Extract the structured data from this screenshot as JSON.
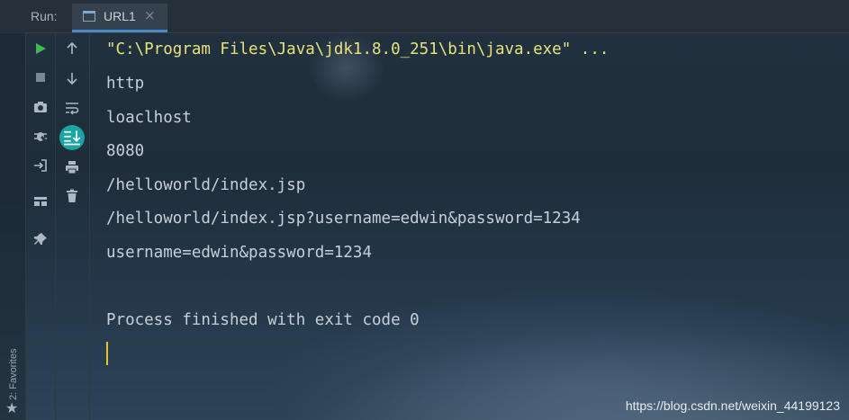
{
  "header": {
    "run_label": "Run:",
    "tab_label": "URL1",
    "tab_close": "×"
  },
  "sidebar": {
    "favorites_label": "2: Favorites",
    "favorites_icon": "star-icon"
  },
  "toolbar_left": [
    {
      "icon": "run-icon",
      "color": "#3fb950"
    },
    {
      "icon": "stop-icon"
    },
    {
      "icon": "camera-icon"
    },
    {
      "icon": "debug-bug-icon"
    },
    {
      "icon": "login-icon"
    },
    {
      "icon": "layout-icon"
    },
    {
      "icon": "pin-icon"
    }
  ],
  "toolbar_right": [
    {
      "icon": "arrow-up-icon"
    },
    {
      "icon": "arrow-down-icon"
    },
    {
      "icon": "soft-wrap-icon"
    },
    {
      "icon": "scroll-to-end-icon",
      "active": true,
      "color": "#1aa4a4"
    },
    {
      "icon": "print-icon"
    },
    {
      "icon": "trash-icon"
    }
  ],
  "console": {
    "lines": [
      "\"C:\\Program Files\\Java\\jdk1.8.0_251\\bin\\java.exe\" ...",
      "http",
      "loaclhost",
      "8080",
      "/helloworld/index.jsp",
      "/helloworld/index.jsp?username=edwin&password=1234",
      "username=edwin&password=1234",
      "",
      "Process finished with exit code 0"
    ]
  },
  "watermark": "https://blog.csdn.net/weixin_44199123",
  "colors": {
    "command": "#e6e37a",
    "output": "#c7d0d8",
    "caret": "#e2c238",
    "accent": "#4a88c7"
  }
}
